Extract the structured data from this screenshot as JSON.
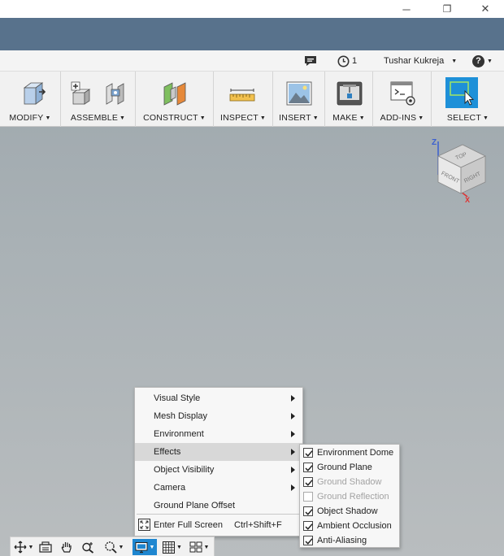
{
  "titlebar": {
    "controls": {
      "minimize": "─",
      "restore": "❐",
      "close": "✕"
    }
  },
  "infobar": {
    "jobs_count": "1",
    "user_name": "Tushar Kukreja",
    "dropdown_caret": "▼",
    "help_symbol": "?"
  },
  "toolbar": {
    "groups": [
      {
        "label": "MODIFY"
      },
      {
        "label": "ASSEMBLE"
      },
      {
        "label": "CONSTRUCT"
      },
      {
        "label": "INSPECT"
      },
      {
        "label": "INSERT"
      },
      {
        "label": "MAKE"
      },
      {
        "label": "ADD-INS"
      },
      {
        "label": "SELECT"
      }
    ],
    "caret": "▼",
    "select_active_color": "#1e90d8"
  },
  "viewcube": {
    "faces": {
      "top": "TOP",
      "front": "FRONT",
      "right": "RIGHT"
    },
    "axes": {
      "z": "Z",
      "x": "X"
    },
    "colors": {
      "z": "#3a5fd0",
      "x": "#e03030",
      "y": "#30b030"
    }
  },
  "display_menu": {
    "items": [
      {
        "label": "Visual Style",
        "has_submenu": true
      },
      {
        "label": "Mesh Display",
        "has_submenu": true
      },
      {
        "label": "Environment",
        "has_submenu": true
      },
      {
        "label": "Effects",
        "has_submenu": true,
        "active": true
      },
      {
        "label": "Object Visibility",
        "has_submenu": true
      },
      {
        "label": "Camera",
        "has_submenu": true
      },
      {
        "label": "Ground Plane Offset",
        "has_submenu": false
      }
    ],
    "fullscreen": {
      "label": "Enter Full Screen",
      "shortcut": "Ctrl+Shift+F"
    }
  },
  "effects_submenu": {
    "items": [
      {
        "label": "Environment Dome",
        "checked": true,
        "enabled": true
      },
      {
        "label": "Ground Plane",
        "checked": true,
        "enabled": true
      },
      {
        "label": "Ground Shadow",
        "checked": true,
        "enabled": false
      },
      {
        "label": "Ground Reflection",
        "checked": false,
        "enabled": false
      },
      {
        "label": "Object Shadow",
        "checked": true,
        "enabled": true
      },
      {
        "label": "Ambient Occlusion",
        "checked": true,
        "enabled": true
      },
      {
        "label": "Anti-Aliasing",
        "checked": true,
        "enabled": true
      }
    ]
  },
  "navbar": {
    "caret": "▼",
    "active_color": "#1e86d0"
  }
}
